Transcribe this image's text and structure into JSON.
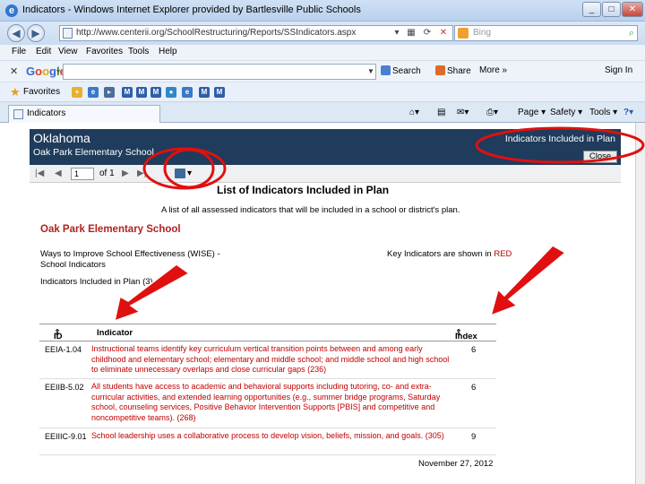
{
  "window": {
    "title": "Indicators - Windows Internet Explorer provided by Bartlesville Public Schools"
  },
  "address": {
    "url": "http://www.centerii.org/SchoolRestructuring/Reports/SSIndicators.aspx",
    "search_placeholder": "Bing"
  },
  "menu": [
    "File",
    "Edit",
    "View",
    "Favorites",
    "Tools",
    "Help"
  ],
  "googlebar": {
    "search_label": "Search",
    "share_label": "Share",
    "more_label": "More »",
    "signin_label": "Sign In"
  },
  "favorites": {
    "label": "Favorites"
  },
  "tab": {
    "label": "Indicators"
  },
  "commandbar": {
    "page": "Page",
    "safety": "Safety",
    "tools": "Tools"
  },
  "report_header": {
    "state": "Oklahoma",
    "school": "Oak Park Elementary School",
    "plan_link": "Indicators Included in Plan",
    "close_label": "Close"
  },
  "viewer_toolbar": {
    "page_value": "1",
    "of_label": "of 1"
  },
  "report": {
    "title": "List of Indicators Included in Plan",
    "subtitle": "A list of all assessed indicators that will be included in a school or district's plan.",
    "school_name": "Oak Park Elementary School",
    "wise_line1": "Ways to Improve School Effectiveness (WISE) -",
    "wise_line2": "School Indicators",
    "key_prefix": "Key Indicators are shown in",
    "key_red": "RED",
    "count_line": "Indicators Included in Plan (3)",
    "date": "November 27, 2012"
  },
  "table": {
    "columns": {
      "id": "ID",
      "indicator": "Indicator",
      "index": "Index"
    },
    "rows": [
      {
        "id": "EEIA-1.04",
        "text": "Instructional teams identify key curriculum vertical transition points between and among early childhood and elementary school; elementary and middle school; and middle school and high school to eliminate unnecessary overlaps and close curricular gaps (236)",
        "index": "6"
      },
      {
        "id": "EEIIB-5.02",
        "text": "All students have access to academic and behavioral supports including tutoring, co- and extra-curricular activities, and extended learning opportunities (e.g., summer bridge programs, Saturday school, counseling services, Positive Behavior Intervention Supports [PBIS] and competitive and noncompetitive teams). (268)",
        "index": "6"
      },
      {
        "id": "EEIIIC-9.01",
        "text": "School leadership uses a collaborative process to develop vision, beliefs, mission, and goals. (305)",
        "index": "9"
      }
    ]
  },
  "colors": {
    "header_bg": "#1f3c5c",
    "key_red": "#c00000",
    "annotation_red": "#e01010"
  }
}
